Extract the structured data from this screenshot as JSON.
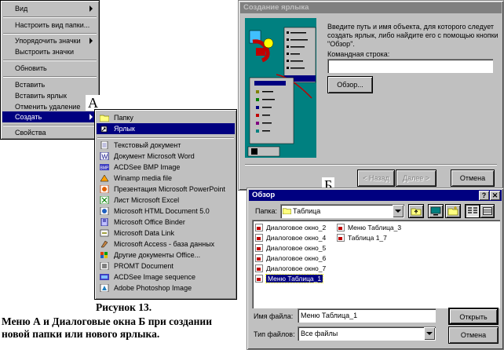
{
  "context_menu": {
    "items": [
      {
        "label": "Вид",
        "submenu": true
      },
      {
        "label": "Настроить вид папки..."
      },
      {
        "label": "Упорядочить значки",
        "submenu": true
      },
      {
        "label": "Выстроить значки"
      },
      {
        "label": "Обновить"
      },
      {
        "label": "Вставить"
      },
      {
        "label": "Вставить ярлык"
      },
      {
        "label": "Отменить удаление"
      },
      {
        "label": "Создать",
        "submenu": true,
        "highlighted": true
      },
      {
        "label": "Свойства"
      }
    ]
  },
  "create_submenu": {
    "items": [
      {
        "label": "Папку",
        "icon": "folder-icon"
      },
      {
        "label": "Ярлык",
        "icon": "shortcut-icon",
        "highlighted": true
      },
      {
        "label": "Текстовый документ",
        "icon": "text-document-icon"
      },
      {
        "label": "Документ Microsoft Word",
        "icon": "word-icon"
      },
      {
        "label": "ACDSee BMP Image",
        "icon": "bmp-icon"
      },
      {
        "label": "Winamp media file",
        "icon": "winamp-icon"
      },
      {
        "label": "Презентация Microsoft PowerPoint",
        "icon": "powerpoint-icon"
      },
      {
        "label": "Лист Microsoft Excel",
        "icon": "excel-icon"
      },
      {
        "label": "Microsoft HTML Document 5.0",
        "icon": "html-icon"
      },
      {
        "label": "Microsoft Office Binder",
        "icon": "binder-icon"
      },
      {
        "label": "Microsoft Data Link",
        "icon": "datalink-icon"
      },
      {
        "label": "Microsoft Access - база данных",
        "icon": "access-icon"
      },
      {
        "label": "Другие документы Office...",
        "icon": "office-icon"
      },
      {
        "label": "PROMT Document",
        "icon": "promt-icon"
      },
      {
        "label": "ACDSee Image sequence",
        "icon": "acdsee-icon"
      },
      {
        "label": "Adobe Photoshop Image",
        "icon": "photoshop-icon"
      }
    ]
  },
  "labels": {
    "a": "А",
    "b": "Б"
  },
  "caption": {
    "line1": "Рисунок 13.",
    "line2": "Меню А и Диалоговые окна Б при создании",
    "line3": "новой папки или нового ярлыка."
  },
  "shortcut_wizard": {
    "title": "Создание ярлыка",
    "instruction": "Введите путь и имя объекта, для которого следует создать ярлык, либо найдите его с помощью кнопки \"Обзор\".",
    "cmdline_label": "Командная строка:",
    "cmdline_value": "",
    "browse_button": "Обзор...",
    "back_button": "< Назад",
    "next_button": "Далее >",
    "cancel_button": "Отмена"
  },
  "browse_dialog": {
    "title": "Обзор",
    "folder_label": "Папка:",
    "folder_value": "Таблица",
    "files_col1": [
      "Диалоговое окно_2",
      "Диалоговое окно_4",
      "Диалоговое окно_5",
      "Диалоговое окно_6",
      "Диалоговое окно_7",
      "Меню Таблица_1"
    ],
    "files_col2": [
      "Меню Таблица_3",
      "Таблица 1_7"
    ],
    "filename_label": "Имя файла:",
    "filename_value": "Меню Таблица_1",
    "filetype_label": "Тип файлов:",
    "filetype_value": "Все файлы",
    "open_button": "Открыть",
    "cancel_button": "Отмена"
  },
  "colors": {
    "highlight": "#000080",
    "face": "#c0c0c0",
    "wizard_teal": "#008080"
  }
}
